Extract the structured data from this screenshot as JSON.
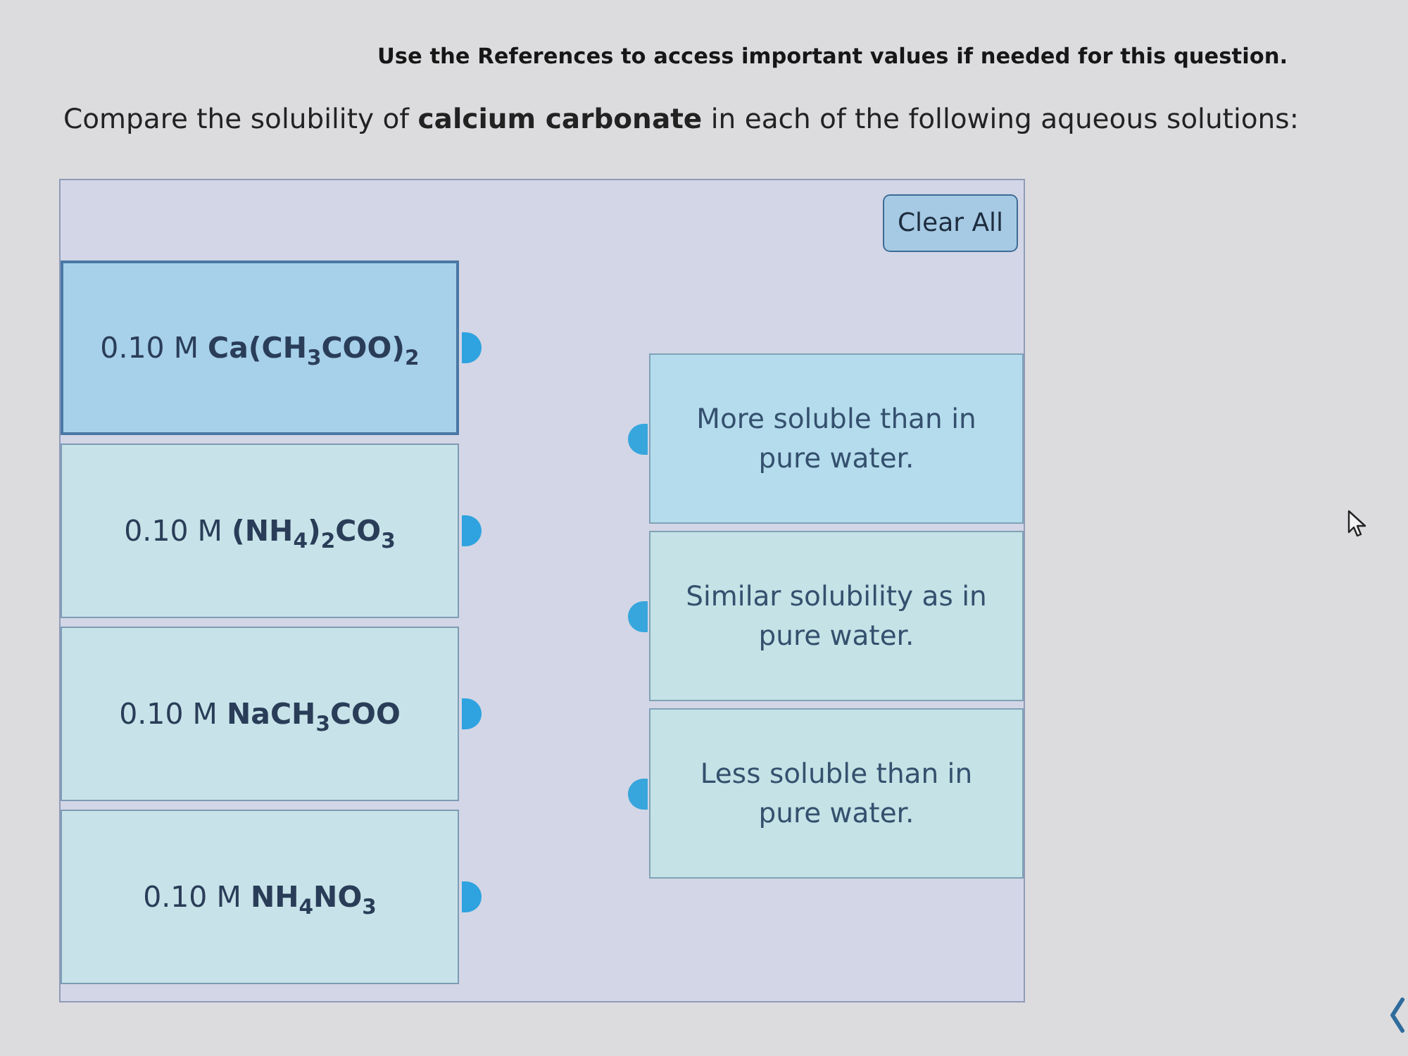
{
  "instruction": "Use the References to access important values if needed for this question.",
  "question": "Compare the solubility of **calcium carbonate** in each of the following aqueous solutions:",
  "clear_button": "Clear All",
  "solutions": [
    {
      "label": "0.10 M **Ca(CH$_{3}$COO)$_{2}$**",
      "selected": true
    },
    {
      "label": "0.10 M **(NH$_{4}$)$_{2}$CO$_{3}$**",
      "selected": false
    },
    {
      "label": "0.10 M **NaCH$_{3}$COO**",
      "selected": false
    },
    {
      "label": "0.10 M **NH$_{4}$NO$_{3}$**",
      "selected": false
    }
  ],
  "answers": [
    {
      "label": "More soluble than in pure water."
    },
    {
      "label": "Similar solubility as in pure water."
    },
    {
      "label": "Less soluble than in pure water."
    }
  ]
}
